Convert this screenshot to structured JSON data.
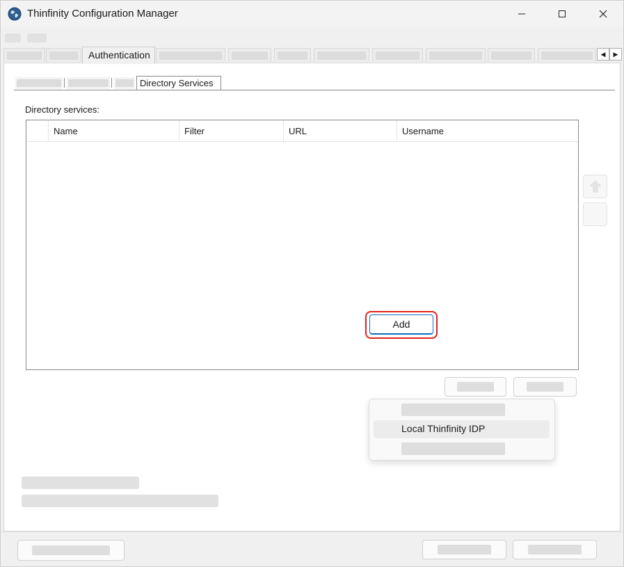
{
  "window": {
    "title": "Thinfinity Configuration Manager"
  },
  "tabs": {
    "active_label": "Authentication"
  },
  "subtabs": {
    "active_label": "Directory Services"
  },
  "directory_services": {
    "label": "Directory services:",
    "columns": [
      "Name",
      "Filter",
      "URL",
      "Username"
    ]
  },
  "buttons": {
    "add_label": "Add"
  },
  "add_menu": {
    "items": [
      "",
      "Local Thinfinity IDP",
      ""
    ]
  },
  "colors": {
    "highlight": "#e0201c",
    "accent": "#0f6cbd"
  }
}
